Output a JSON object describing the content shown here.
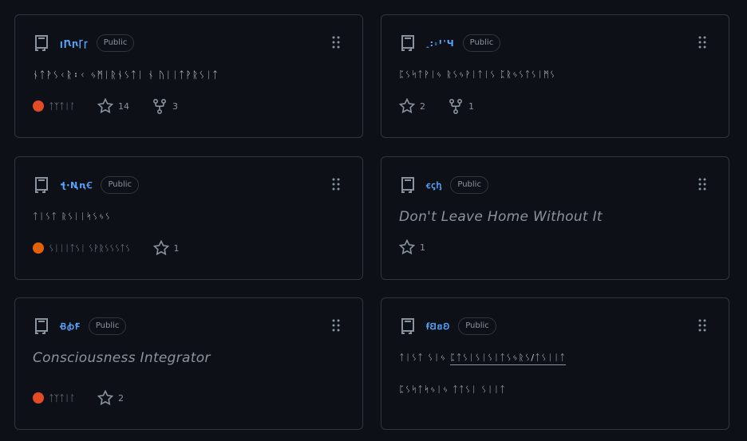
{
  "colors": {
    "background": "#0d1117",
    "border": "#30363d",
    "link": "#58a6ff",
    "muted": "#8b949e",
    "text": "#c9d1d9",
    "lang_orange_red": "#e34c26",
    "lang_orange": "#e36209"
  },
  "cards": [
    {
      "name": "ꞁꞂꞃꞄꞅ",
      "badge": "Public",
      "description": "ᚾᛏᚹᛊᚲᚱ᛬ᚲ ᛃᛗᛁᚱᚾᛊᛏᛁ ᚾ ᚢᛁᛁᛏᚹᚱᛊᛁᛏ",
      "language": "ᛏᛉᛏᛁᛚ",
      "language_color": "#e34c26",
      "stars": "14",
      "forks": "3"
    },
    {
      "name": "ꞈ꞉꞊ꞋꞌꞍ",
      "badge": "Public",
      "description": "ᛈᛊᛋᛏᚹᛁᛃ ᚱᛊᛃᚹᛁᛏᛁᛊ ᛈᚱᛃᛊᛏᛊᛁᛗᛊ",
      "stars": "2",
      "forks": "1"
    },
    {
      "name": "ꞎꞏꞐꞑꞒ",
      "badge": "Public",
      "description": "ᛏᛁᛊᛏ ᚱᛊᛁᛁᛋᛊᛃᛊ",
      "language": "ᛊᛁᛁᛁᛏᛊᛁ ᛊᚹᚱᛊᛊᛊᛏᛊ",
      "language_color": "#e36209",
      "stars": "1"
    },
    {
      "name": "ꞓꞔꞕ",
      "badge": "Public",
      "description": "Don't Leave Home Without It",
      "stars": "1"
    },
    {
      "name": "ꞖꞗꞘ",
      "badge": "Public",
      "description": "Consciousness Integrator",
      "language": "ᛏᛉᛏᛁᛚ",
      "language_color": "#e34c26",
      "stars": "2"
    },
    {
      "name": "ꞙꞚꞛꞜ",
      "badge": "Public",
      "description_prefix": "ᛏᛁᛊᛏ ᛊᛁᛃ",
      "description_link": "ᛈᛏᛊᛁᛊᛁᛊᛁᛏᛊᛃᚱᛊ/ᛏᛊᛁᛁᛏ",
      "description_line2": "ᛈᛊᛋᛏᛋᛃᛁᛃ ᛏᛏᛊᛁ ᛊᛁᛁᛏ"
    }
  ]
}
